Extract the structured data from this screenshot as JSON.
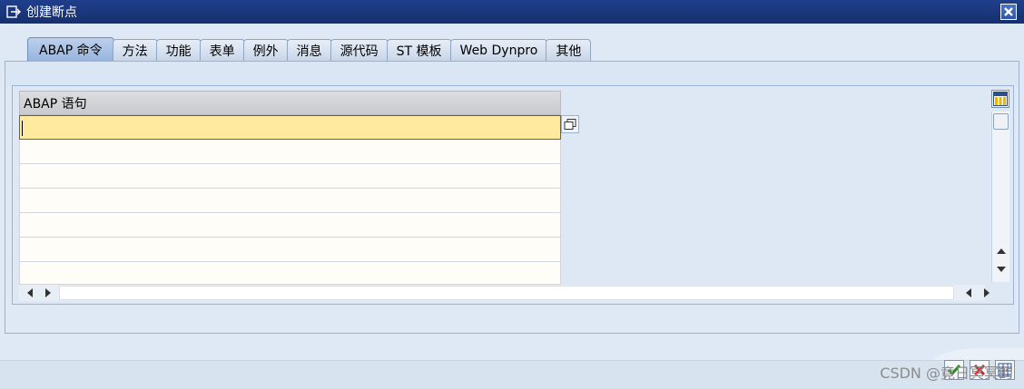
{
  "window": {
    "title": "创建断点"
  },
  "tabs": [
    {
      "label": "ABAP 命令",
      "active": true
    },
    {
      "label": "方法",
      "active": false
    },
    {
      "label": "功能",
      "active": false
    },
    {
      "label": "表单",
      "active": false
    },
    {
      "label": "例外",
      "active": false
    },
    {
      "label": "消息",
      "active": false
    },
    {
      "label": "源代码",
      "active": false
    },
    {
      "label": "ST 模板",
      "active": false
    },
    {
      "label": "Web Dynpro",
      "active": false
    },
    {
      "label": "其他",
      "active": false
    }
  ],
  "grid": {
    "column_header": "ABAP 语句",
    "rows": [
      "",
      "",
      "",
      "",
      "",
      "",
      ""
    ],
    "selected_row": 0
  },
  "watermark": "CSDN @竟日冥冥的"
}
